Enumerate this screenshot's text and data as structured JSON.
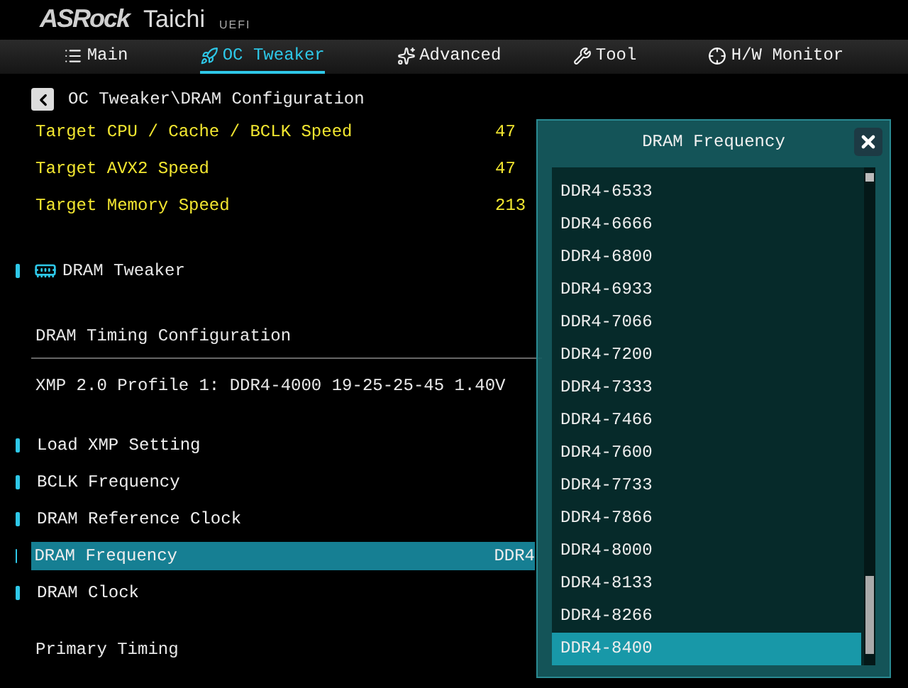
{
  "header": {
    "brand": "ASRock",
    "model": "Taichi",
    "firmware": "UEFI"
  },
  "tabs": [
    {
      "label": "Main",
      "selected": false
    },
    {
      "label": "OC Tweaker",
      "selected": true
    },
    {
      "label": "Advanced",
      "selected": false
    },
    {
      "label": "Tool",
      "selected": false
    },
    {
      "label": "H/W Monitor",
      "selected": false
    }
  ],
  "breadcrumb": "OC Tweaker\\DRAM Configuration",
  "targets": [
    {
      "label": "Target CPU / Cache / BCLK Speed",
      "value": "47"
    },
    {
      "label": "Target AVX2 Speed",
      "value": "47"
    },
    {
      "label": "Target Memory Speed",
      "value": "213"
    }
  ],
  "section": "DRAM Tweaker",
  "timing_config": "DRAM Timing Configuration",
  "xmp_profile": "XMP 2.0 Profile 1: DDR4-4000 19-25-25-45 1.40V",
  "settings": [
    {
      "label": "Load XMP Setting",
      "selected": false
    },
    {
      "label": "BCLK Frequency",
      "selected": false
    },
    {
      "label": "DRAM Reference Clock",
      "selected": false
    },
    {
      "label": "DRAM Frequency",
      "value": "DDR4",
      "selected": true
    },
    {
      "label": "DRAM Clock",
      "selected": false
    }
  ],
  "primary_timing": "Primary Timing",
  "dialog": {
    "title": "DRAM Frequency",
    "options": [
      {
        "label": "DDR4-6533",
        "selected": false
      },
      {
        "label": "DDR4-6666",
        "selected": false
      },
      {
        "label": "DDR4-6800",
        "selected": false
      },
      {
        "label": "DDR4-6933",
        "selected": false
      },
      {
        "label": "DDR4-7066",
        "selected": false
      },
      {
        "label": "DDR4-7200",
        "selected": false
      },
      {
        "label": "DDR4-7333",
        "selected": false
      },
      {
        "label": "DDR4-7466",
        "selected": false
      },
      {
        "label": "DDR4-7600",
        "selected": false
      },
      {
        "label": "DDR4-7733",
        "selected": false
      },
      {
        "label": "DDR4-7866",
        "selected": false
      },
      {
        "label": "DDR4-8000",
        "selected": false
      },
      {
        "label": "DDR4-8133",
        "selected": false
      },
      {
        "label": "DDR4-8266",
        "selected": false
      },
      {
        "label": "DDR4-8400",
        "selected": true
      }
    ]
  }
}
